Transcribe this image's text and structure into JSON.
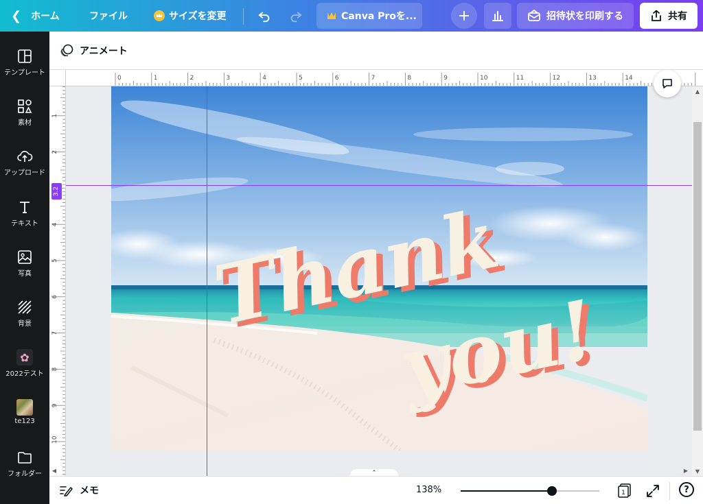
{
  "topbar": {
    "home": "ホーム",
    "file": "ファイル",
    "resize": "サイズを変更",
    "pro": "Canva Proを...",
    "print": "招待状を印刷する",
    "share": "共有"
  },
  "sidebar": {
    "items": [
      {
        "label": "テンプレート",
        "icon": "template-icon"
      },
      {
        "label": "素材",
        "icon": "elements-icon"
      },
      {
        "label": "アップロード",
        "icon": "upload-icon"
      },
      {
        "label": "テキスト",
        "icon": "text-icon"
      },
      {
        "label": "写真",
        "icon": "photo-icon"
      },
      {
        "label": "背景",
        "icon": "background-icon"
      },
      {
        "label": "2022テスト",
        "icon": "flower-icon"
      },
      {
        "label": "te123",
        "icon": "thumbnail-icon"
      },
      {
        "label": "フォルダー",
        "icon": "folder-icon"
      }
    ]
  },
  "animbar": {
    "label": "アニメート"
  },
  "ruler": {
    "h_ticks": [
      "0",
      "1",
      "2",
      "3",
      "4",
      "5",
      "6",
      "7",
      "8",
      "9",
      "10",
      "11",
      "12",
      "13",
      "14",
      "15"
    ],
    "v_ticks": [
      "1",
      "2",
      "3",
      "4",
      "5",
      "6",
      "7",
      "8",
      "9",
      "10"
    ],
    "guide_value": "3.2"
  },
  "design": {
    "line1": "Thank",
    "line2": "you!",
    "text_color": "#f8f0e1",
    "shadow_color": "#ee7b6a"
  },
  "bottombar": {
    "notes": "メモ",
    "zoom": "138%",
    "zoom_level": 0.66,
    "page_count": "1",
    "help": "?"
  },
  "colors": {
    "accent": "#8b3dff",
    "sidebar_bg": "#18191b"
  }
}
